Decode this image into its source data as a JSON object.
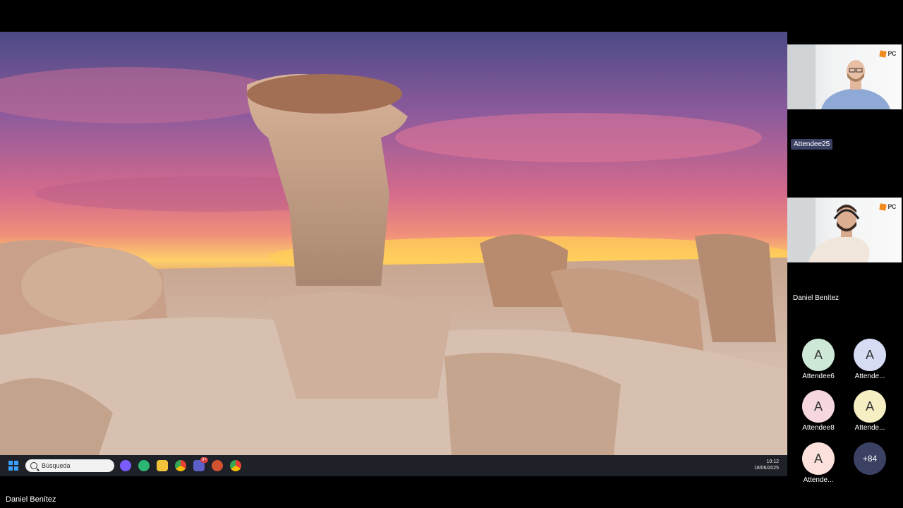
{
  "shared_screen": {
    "taskbar": {
      "search_placeholder": "Búsqueda",
      "apps": [
        {
          "icon": "copilot-icon",
          "color": "#7b5cff"
        },
        {
          "icon": "edge-icon",
          "color": "#2bb673"
        },
        {
          "icon": "file-explorer-icon",
          "color": "#f3c23b"
        },
        {
          "icon": "chrome-icon",
          "color": "#e94235"
        },
        {
          "icon": "teams-icon",
          "color": "#5b5fc7",
          "badge": "9+"
        },
        {
          "icon": "powerpoint-icon",
          "color": "#d35230"
        },
        {
          "icon": "chrome-icon",
          "color": "#e94235"
        }
      ],
      "time": "10:12",
      "date": "18/06/2025"
    },
    "presenter_name": "Daniel Benítez"
  },
  "participants": {
    "video_tiles": [
      {
        "name": "Attendee25"
      },
      {
        "name": "Daniel Benítez"
      }
    ],
    "logo_text": "PC",
    "avatars": [
      {
        "initial": "A",
        "name": "Attendee6",
        "color": "#cde8d6"
      },
      {
        "initial": "A",
        "name": "Attende...",
        "color": "#d7dcf5"
      },
      {
        "initial": "A",
        "name": "Attendee8",
        "color": "#f6d7de"
      },
      {
        "initial": "A",
        "name": "Attende...",
        "color": "#f7efc4"
      },
      {
        "initial": "A",
        "name": "Attende...",
        "color": "#fbe0dc"
      }
    ],
    "more_count": "+84"
  }
}
